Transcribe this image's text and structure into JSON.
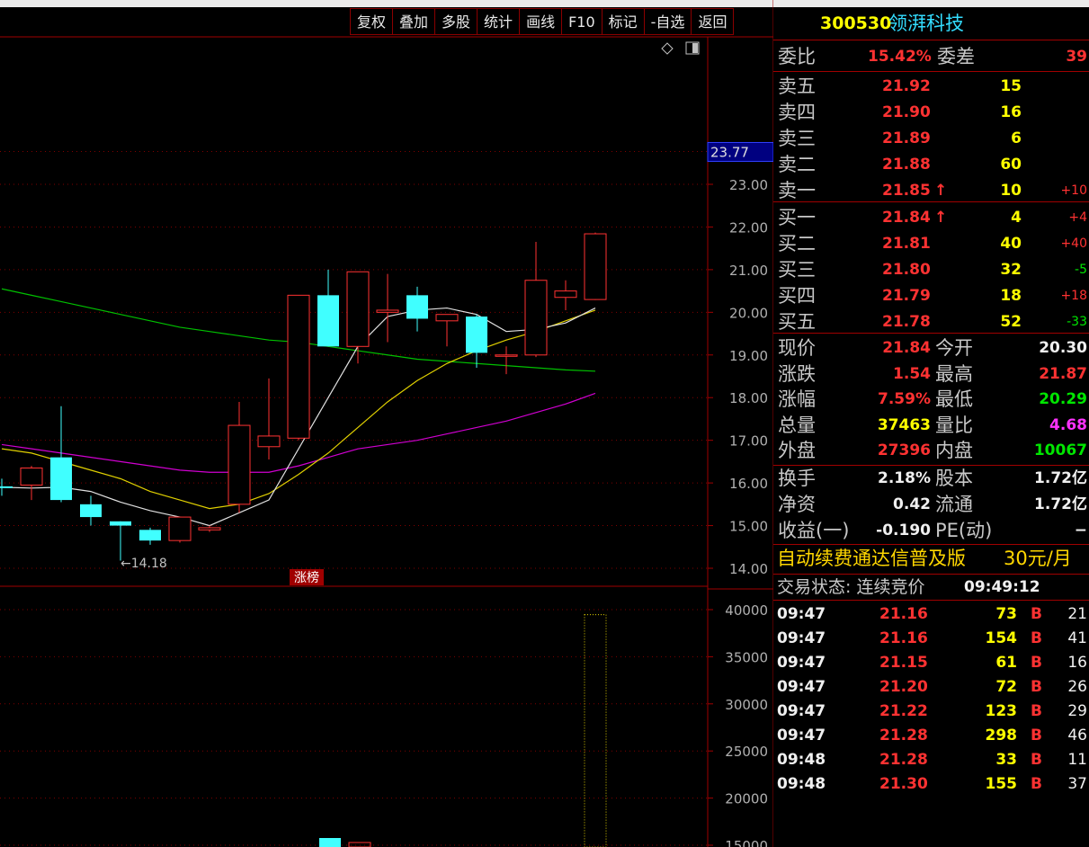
{
  "toolbar": [
    "复权",
    "叠加",
    "多股",
    "统计",
    "画线",
    "F10",
    "标记",
    "-自选",
    "返回"
  ],
  "chart_ui": {
    "axis_marker": "23.77",
    "label_low": "←14.18",
    "badge": "涨榜",
    "price_ticks": [
      "23.00",
      "22.00",
      "21.00",
      "20.00",
      "19.00",
      "18.00",
      "17.00",
      "16.00",
      "15.00",
      "14.00"
    ],
    "volume_ticks": [
      "40000",
      "35000",
      "30000",
      "25000",
      "20000",
      "15000"
    ]
  },
  "chart_data": {
    "type": "candlestick",
    "candles": [
      {
        "o": 15.92,
        "c": 15.88,
        "h": 16.1,
        "l": 15.7
      },
      {
        "o": 15.95,
        "c": 16.35,
        "h": 16.4,
        "l": 15.6
      },
      {
        "o": 16.6,
        "c": 15.6,
        "h": 17.8,
        "l": 15.55
      },
      {
        "o": 15.5,
        "c": 15.2,
        "h": 15.7,
        "l": 15.0
      },
      {
        "o": 15.1,
        "c": 15.0,
        "h": 15.1,
        "l": 14.18
      },
      {
        "o": 14.9,
        "c": 14.65,
        "h": 14.95,
        "l": 14.55
      },
      {
        "o": 14.65,
        "c": 15.2,
        "h": 15.2,
        "l": 14.6
      },
      {
        "o": 14.9,
        "c": 14.95,
        "h": 15.0,
        "l": 14.85
      },
      {
        "o": 15.5,
        "c": 17.35,
        "h": 17.9,
        "l": 15.3
      },
      {
        "o": 16.85,
        "c": 17.1,
        "h": 18.45,
        "l": 16.55
      },
      {
        "o": 17.05,
        "c": 20.4,
        "h": 20.4,
        "l": 17.0
      },
      {
        "o": 20.4,
        "c": 19.2,
        "h": 21.0,
        "l": 19.2
      },
      {
        "o": 19.2,
        "c": 20.95,
        "h": 20.95,
        "l": 18.8
      },
      {
        "o": 20.0,
        "c": 20.05,
        "h": 20.9,
        "l": 19.3
      },
      {
        "o": 20.4,
        "c": 19.85,
        "h": 20.6,
        "l": 19.55
      },
      {
        "o": 19.8,
        "c": 19.95,
        "h": 19.95,
        "l": 19.2
      },
      {
        "o": 19.9,
        "c": 19.05,
        "h": 19.95,
        "l": 18.7
      },
      {
        "o": 19.0,
        "c": 19.0,
        "h": 19.2,
        "l": 18.55
      },
      {
        "o": 19.0,
        "c": 20.75,
        "h": 21.65,
        "l": 18.95
      },
      {
        "o": 20.35,
        "c": 20.5,
        "h": 20.75,
        "l": 20.05
      },
      {
        "o": 20.3,
        "c": 21.84,
        "h": 21.87,
        "l": 20.29
      }
    ],
    "ma_white": [
      15.9,
      15.88,
      15.9,
      15.8,
      15.55,
      15.35,
      15.2,
      15.0,
      15.3,
      15.6,
      16.8,
      18.0,
      19.2,
      19.9,
      20.05,
      20.1,
      19.95,
      19.55,
      19.6,
      19.75,
      20.1
    ],
    "ma_yellow": [
      16.8,
      16.7,
      16.5,
      16.3,
      16.1,
      15.8,
      15.6,
      15.4,
      15.5,
      15.75,
      16.2,
      16.7,
      17.3,
      17.9,
      18.4,
      18.8,
      19.1,
      19.35,
      19.55,
      19.8,
      20.05
    ],
    "ma_green": [
      20.55,
      20.4,
      20.25,
      20.1,
      19.95,
      19.8,
      19.65,
      19.55,
      19.45,
      19.35,
      19.3,
      19.2,
      19.1,
      19.0,
      18.9,
      18.85,
      18.8,
      18.75,
      18.7,
      18.65,
      18.62
    ],
    "ma_magenta": [
      16.9,
      16.8,
      16.7,
      16.6,
      16.5,
      16.4,
      16.3,
      16.25,
      16.25,
      16.25,
      16.4,
      16.6,
      16.8,
      16.9,
      17.0,
      17.15,
      17.3,
      17.45,
      17.65,
      17.85,
      18.1
    ],
    "volume_last": 39463,
    "ylim": [
      14.0,
      24.0
    ],
    "volume_ylim": [
      15000,
      40000
    ]
  },
  "quote": {
    "code": "300530",
    "name": "领湃科技",
    "weibi_label": "委比",
    "weibi_val": "15.42%",
    "weicha_label": "委差",
    "weicha_val": "39",
    "asks": [
      {
        "label": "卖五",
        "price": "21.92",
        "vol": "15",
        "chg": "",
        "arrow": ""
      },
      {
        "label": "卖四",
        "price": "21.90",
        "vol": "16",
        "chg": "",
        "arrow": ""
      },
      {
        "label": "卖三",
        "price": "21.89",
        "vol": "6",
        "chg": "",
        "arrow": ""
      },
      {
        "label": "卖二",
        "price": "21.88",
        "vol": "60",
        "chg": "",
        "arrow": ""
      },
      {
        "label": "卖一",
        "price": "21.85",
        "vol": "10",
        "chg": "+10",
        "arrow": "↑"
      }
    ],
    "bids": [
      {
        "label": "买一",
        "price": "21.84",
        "vol": "4",
        "chg": "+4",
        "arrow": "↑"
      },
      {
        "label": "买二",
        "price": "21.81",
        "vol": "40",
        "chg": "+40",
        "arrow": ""
      },
      {
        "label": "买三",
        "price": "21.80",
        "vol": "32",
        "chg": "-5",
        "arrow": ""
      },
      {
        "label": "买四",
        "price": "21.79",
        "vol": "18",
        "chg": "+18",
        "arrow": ""
      },
      {
        "label": "买五",
        "price": "21.78",
        "vol": "52",
        "chg": "-33",
        "arrow": ""
      }
    ],
    "stats": [
      {
        "l1": "现价",
        "v1": "21.84",
        "c1": "red",
        "l2": "今开",
        "v2": "20.30",
        "c2": "wht"
      },
      {
        "l1": "涨跌",
        "v1": "1.54",
        "c1": "red",
        "l2": "最高",
        "v2": "21.87",
        "c2": "red"
      },
      {
        "l1": "涨幅",
        "v1": "7.59%",
        "c1": "red",
        "l2": "最低",
        "v2": "20.29",
        "c2": "grn"
      },
      {
        "l1": "总量",
        "v1": "37463",
        "c1": "yel",
        "l2": "量比",
        "v2": "4.68",
        "c2": "mag"
      },
      {
        "l1": "外盘",
        "v1": "27396",
        "c1": "red",
        "l2": "内盘",
        "v2": "10067",
        "c2": "grn"
      }
    ],
    "fund": [
      {
        "l1": "换手",
        "v1": "2.18%",
        "l2": "股本",
        "v2": "1.72亿"
      },
      {
        "l1": "净资",
        "v1": "0.42",
        "l2": "流通",
        "v2": "1.72亿"
      },
      {
        "l1": "收益(一)",
        "v1": "-0.190",
        "l2": "PE(动)",
        "v2": "−"
      }
    ],
    "ad_text": "自动续费通达信普及版",
    "ad_price": "30元/月",
    "status_label": "交易状态: 连续竞价",
    "status_time": "09:49:12",
    "ticks": [
      {
        "t": "09:47",
        "p": "21.16",
        "v": "73",
        "bs": "B",
        "n": "21"
      },
      {
        "t": "09:47",
        "p": "21.16",
        "v": "154",
        "bs": "B",
        "n": "41"
      },
      {
        "t": "09:47",
        "p": "21.15",
        "v": "61",
        "bs": "B",
        "n": "16"
      },
      {
        "t": "09:47",
        "p": "21.20",
        "v": "72",
        "bs": "B",
        "n": "26"
      },
      {
        "t": "09:47",
        "p": "21.22",
        "v": "123",
        "bs": "B",
        "n": "29"
      },
      {
        "t": "09:47",
        "p": "21.28",
        "v": "298",
        "bs": "B",
        "n": "46"
      },
      {
        "t": "09:48",
        "p": "21.28",
        "v": "33",
        "bs": "B",
        "n": "11"
      },
      {
        "t": "09:48",
        "p": "21.30",
        "v": "155",
        "bs": "B",
        "n": "37"
      }
    ]
  }
}
